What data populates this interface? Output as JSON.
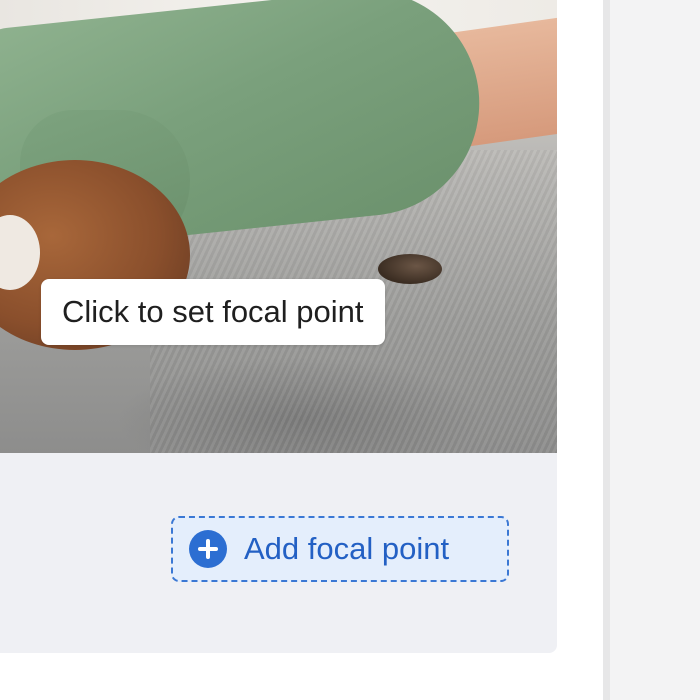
{
  "image_area": {
    "tooltip_text": "Click to set focal point"
  },
  "actions": {
    "add_focal_point_label": "Add focal point",
    "add_icon": "plus-circle-icon"
  },
  "colors": {
    "accent": "#2c6ed2",
    "accent_text": "#2360c4",
    "button_background": "#e4eefc",
    "card_background": "#eff0f4"
  }
}
